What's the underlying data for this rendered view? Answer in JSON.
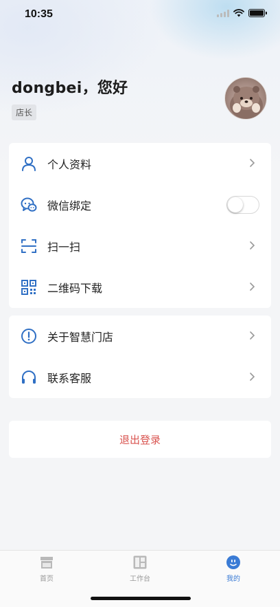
{
  "status_bar": {
    "time": "10:35",
    "battery_level": 1.0
  },
  "header": {
    "greeting": "dongbei，您好",
    "role": "店长"
  },
  "menu_group_1": [
    {
      "label": "个人资料",
      "icon": "user-icon",
      "control": "chevron"
    },
    {
      "label": "微信绑定",
      "icon": "wechat-icon",
      "control": "toggle",
      "toggle_on": false
    },
    {
      "label": "扫一扫",
      "icon": "scan-icon",
      "control": "chevron"
    },
    {
      "label": "二维码下载",
      "icon": "qr-code-icon",
      "control": "chevron"
    }
  ],
  "menu_group_2": [
    {
      "label": "关于智慧门店",
      "icon": "info-icon",
      "control": "chevron"
    },
    {
      "label": "联系客服",
      "icon": "headset-icon",
      "control": "chevron"
    }
  ],
  "logout": {
    "label": "退出登录"
  },
  "tabbar": {
    "tabs": [
      {
        "label": "首页",
        "icon": "store-icon",
        "active": false
      },
      {
        "label": "工作台",
        "icon": "dashboard-icon",
        "active": false
      },
      {
        "label": "我的",
        "icon": "smiley-icon",
        "active": true
      }
    ]
  },
  "colors": {
    "accent": "#3a7bd5",
    "icon_blue": "#2f6fc4",
    "logout_red": "#d9534f",
    "background": "#f4f5f7"
  }
}
